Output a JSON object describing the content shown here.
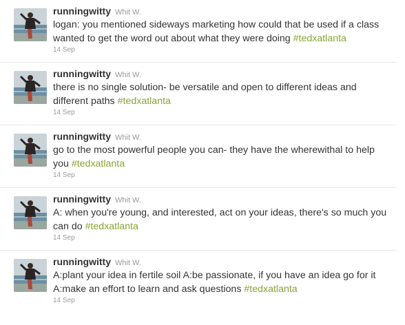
{
  "tweets": [
    {
      "screen_name": "runningwitty",
      "full_name": "Whit W.",
      "text": "logan: you mentioned sideways marketing how could that be used if a class wanted to get the word out about what they were doing",
      "hashtag": "#tedxatlanta",
      "timestamp": "14 Sep",
      "avatar_icon": "profile-photo"
    },
    {
      "screen_name": "runningwitty",
      "full_name": "Whit W.",
      "text": "there is no single solution- be versatile and open to different ideas and different paths",
      "hashtag": "#tedxatlanta",
      "timestamp": "14 Sep",
      "avatar_icon": "profile-photo"
    },
    {
      "screen_name": "runningwitty",
      "full_name": "Whit W.",
      "text": "go to the most powerful people you can- they have the wherewithal to help you",
      "hashtag": "#tedxatlanta",
      "timestamp": "14 Sep",
      "avatar_icon": "profile-photo"
    },
    {
      "screen_name": "runningwitty",
      "full_name": "Whit W.",
      "text": "A: when you're young, and interested, act on your ideas, there's so much you can do",
      "hashtag": "#tedxatlanta",
      "timestamp": "14 Sep",
      "avatar_icon": "profile-photo"
    },
    {
      "screen_name": "runningwitty",
      "full_name": "Whit W.",
      "text": "A:plant your idea in fertile soil A:be passionate, if you have an idea go for it A:make an effort to learn and ask questions",
      "hashtag": "#tedxatlanta",
      "timestamp": "14 Sep",
      "avatar_icon": "profile-photo"
    }
  ],
  "colors": {
    "hashtag": "#88a335",
    "meta": "#999999",
    "text": "#333333",
    "divider": "#e8e8e8"
  }
}
